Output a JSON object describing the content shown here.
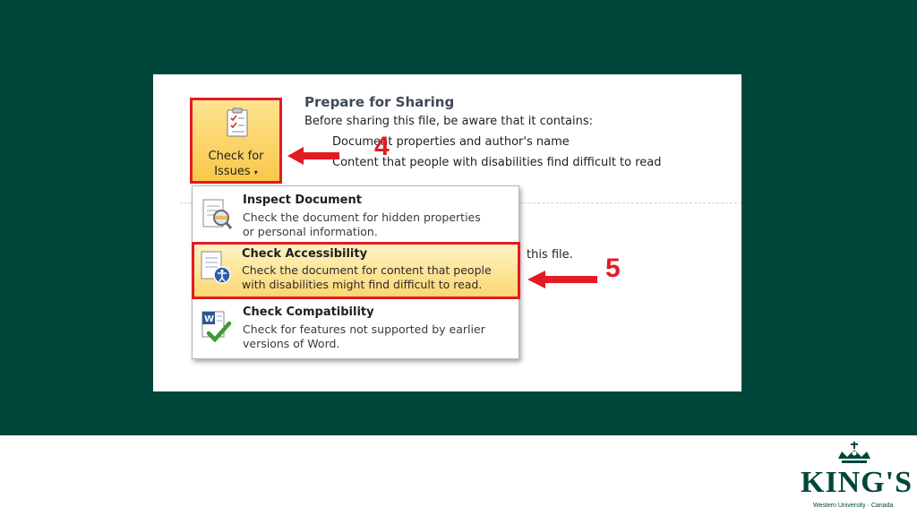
{
  "sharing": {
    "title": "Prepare for Sharing",
    "description": "Before sharing this file, be aware that it contains:",
    "bullets": [
      "Document properties and author's name",
      "Content that people with disabilities find difficult to read"
    ],
    "tail_text": "this file."
  },
  "check_button": {
    "label_line1": "Check for",
    "label_line2": "Issues",
    "icon": "checklist-icon",
    "caret": "▾"
  },
  "menu": {
    "items": [
      {
        "title": "Inspect Document",
        "desc_line1": "Check the document for hidden properties",
        "desc_line2": "or personal information.",
        "icon": "inspect-document-icon"
      },
      {
        "title": "Check Accessibility",
        "desc_line1": "Check the document for content that people",
        "desc_line2": "with disabilities might find difficult to read.",
        "icon": "accessibility-icon"
      },
      {
        "title": "Check Compatibility",
        "desc_line1": "Check for features not supported by earlier",
        "desc_line2": "versions of Word.",
        "icon": "word-compatibility-icon"
      }
    ]
  },
  "callouts": [
    "4",
    "5"
  ],
  "logo": {
    "wordmark": "KING'S",
    "subtitle": "Western University · Canada"
  },
  "colors": {
    "background": "#01463a",
    "highlight_border": "#e31b23",
    "button_fill": "#f9c84a",
    "hover_fill": "#fbd772"
  }
}
